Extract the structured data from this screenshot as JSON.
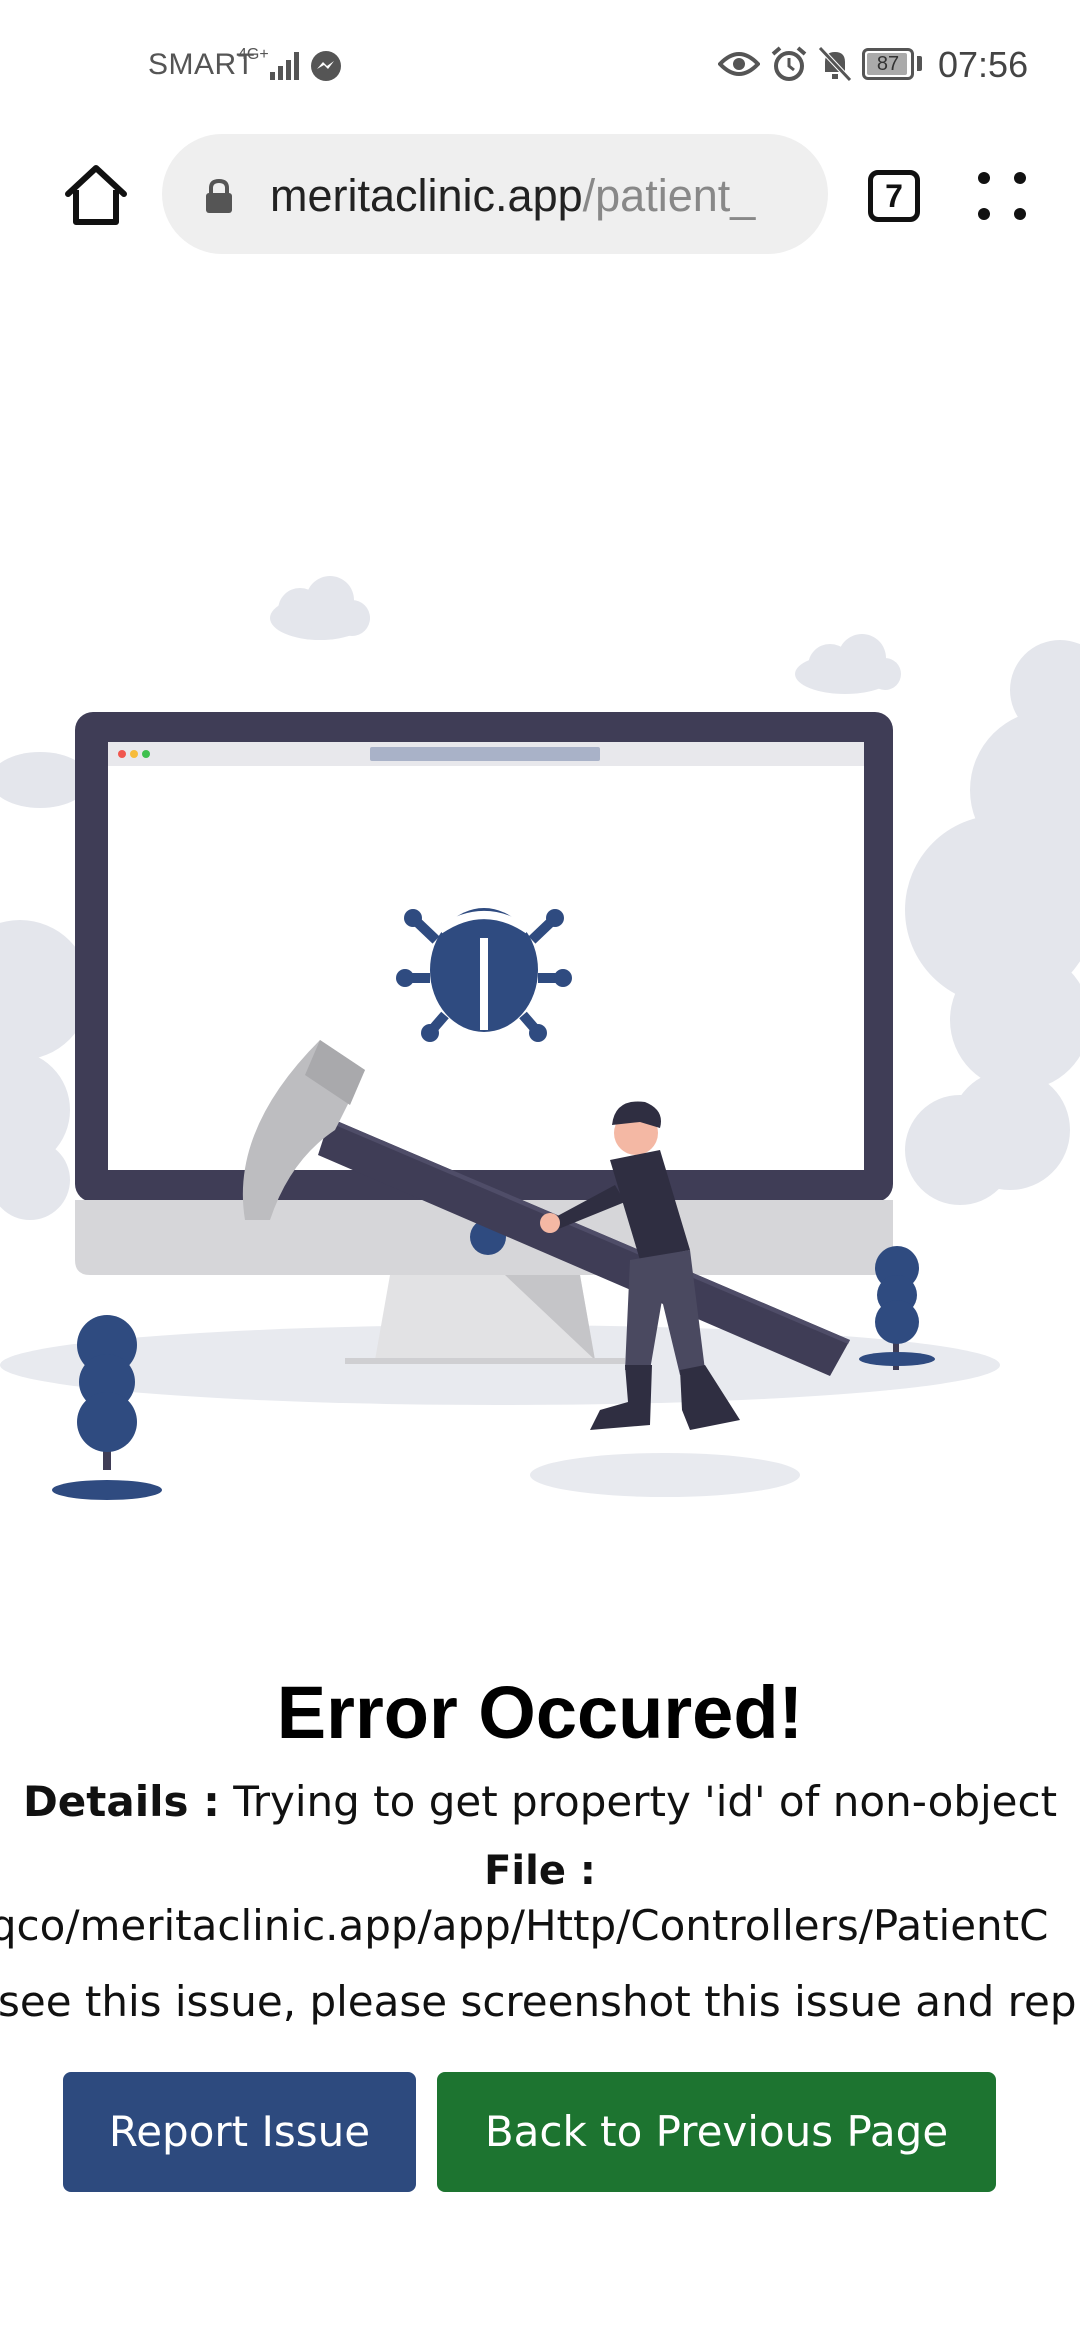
{
  "status_bar": {
    "carrier": "SMART",
    "network_type": "4G+",
    "battery_level": "87",
    "time": "07:56"
  },
  "browser": {
    "url_domain": "meritaclinic.app",
    "url_path": "/patient_",
    "tab_count": "7"
  },
  "error": {
    "title": "Error Occured!",
    "details_label": "Details :",
    "details_text": "Trying to get property 'id' of non-object",
    "file_label": "File :",
    "file_path": "sqco/meritaclinic.app/app/Http/Controllers/PatientC",
    "report_message": "u see this issue, please screenshot this issue and rep"
  },
  "buttons": {
    "report_label": "Report Issue",
    "back_label": "Back to Previous Page"
  },
  "colors": {
    "report_button": "#2d4a7e",
    "back_button": "#1d7430",
    "illustration_accent": "#2f4b80",
    "monitor_frame": "#3f3d56"
  }
}
